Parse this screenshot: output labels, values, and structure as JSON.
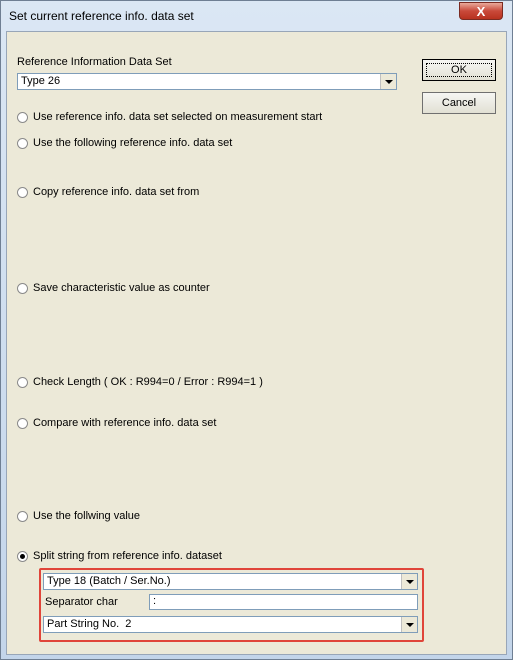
{
  "window": {
    "title": "Set current reference info. data set",
    "close_glyph": "X"
  },
  "reference": {
    "label": "Reference Information Data Set",
    "selected": "Type 26"
  },
  "buttons": {
    "ok": "OK",
    "cancel": "Cancel"
  },
  "options": [
    {
      "label": "Use reference info. data set selected on measurement start",
      "checked": false
    },
    {
      "label": "Use the following reference info. data set",
      "checked": false
    },
    {
      "label": "Copy reference info. data set from",
      "checked": false
    },
    {
      "label": "Save characteristic value as counter",
      "checked": false
    },
    {
      "label": "Check Length ( OK : R994=0 / Error : R994=1 )",
      "checked": false
    },
    {
      "label": "Compare with reference info. data set",
      "checked": false
    },
    {
      "label": "Use the follwing value",
      "checked": false
    },
    {
      "label": "Split string from reference info. dataset",
      "checked": true
    }
  ],
  "split": {
    "dataset_selected": "Type 18 (Batch / Ser.No.)",
    "separator_label": "Separator char",
    "separator_value": ":",
    "part_selected": "Part String No.  2",
    "highlight_color": "#e0453a"
  }
}
